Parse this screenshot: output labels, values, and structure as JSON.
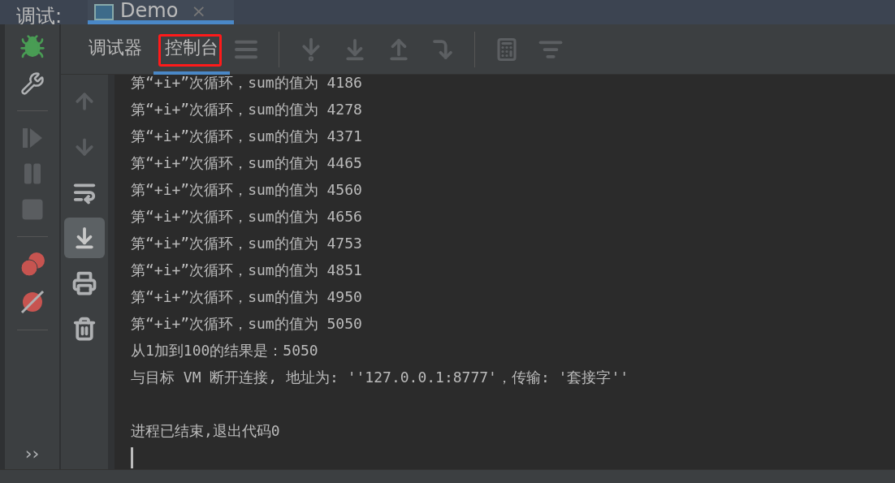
{
  "window": {
    "title": "调试:"
  },
  "editor_tabs": [
    {
      "label": "Demo",
      "selected": true,
      "close": "×"
    }
  ],
  "debug_tabs": [
    {
      "label": "调试器",
      "selected": false
    },
    {
      "label": "控制台",
      "selected": true
    }
  ],
  "console": {
    "lines": [
      "第“+i+”次循环，sum的值为 4186",
      "第“+i+”次循环，sum的值为 4278",
      "第“+i+”次循环，sum的值为 4371",
      "第“+i+”次循环，sum的值为 4465",
      "第“+i+”次循环，sum的值为 4560",
      "第“+i+”次循环，sum的值为 4656",
      "第“+i+”次循环，sum的值为 4753",
      "第“+i+”次循环，sum的值为 4851",
      "第“+i+”次循环，sum的值为 4950",
      "第“+i+”次循环，sum的值为 5050",
      "从1加到100的结果是：5050",
      "与目标 VM 断开连接, 地址为: ''127.0.0.1:8777'，传输: '套接字''"
    ],
    "exit_message": "进程已结束,退出代码0"
  },
  "side_more": "››"
}
